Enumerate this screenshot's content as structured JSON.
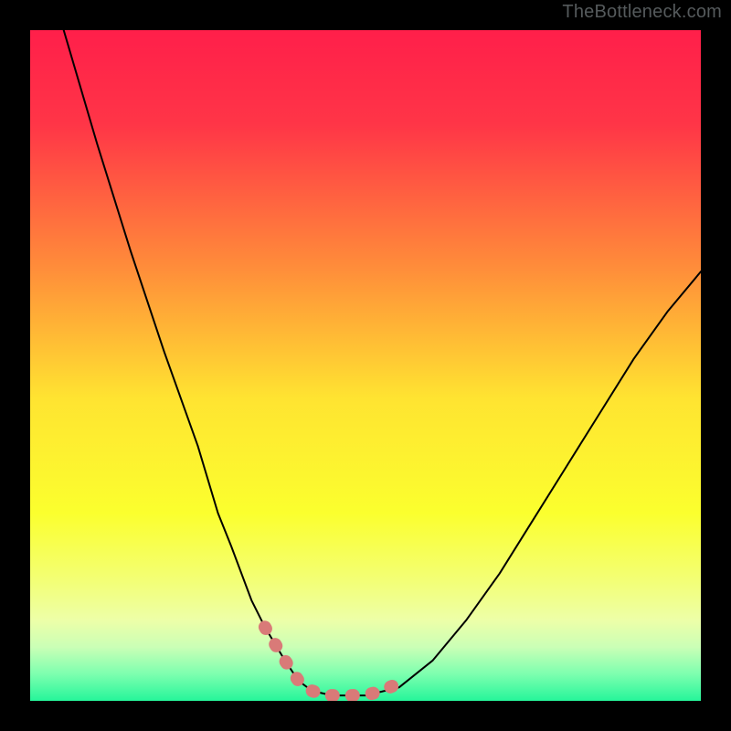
{
  "watermark": "TheBottleneck.com",
  "chart_data": {
    "type": "line",
    "title": "",
    "xlabel": "",
    "ylabel": "",
    "xlim": [
      0,
      100
    ],
    "ylim": [
      0,
      100
    ],
    "series": [
      {
        "name": "bottleneck-curve",
        "x": [
          5,
          10,
          15,
          20,
          25,
          28,
          30,
          33,
          35,
          38,
          40,
          42,
          45,
          50,
          55,
          60,
          65,
          70,
          75,
          80,
          85,
          90,
          95,
          100
        ],
        "values": [
          100,
          83,
          67,
          52,
          38,
          28,
          23,
          15,
          11,
          6,
          3,
          1.5,
          0.8,
          0.8,
          2,
          6,
          12,
          19,
          27,
          35,
          43,
          51,
          58,
          64
        ]
      }
    ],
    "highlight_strip": {
      "name": "highlighted-optimal-segment",
      "x": [
        35,
        38,
        40,
        42,
        44,
        46,
        48,
        50,
        52,
        54
      ],
      "values": [
        11,
        6,
        3,
        1.5,
        0.8,
        0.8,
        0.8,
        0.9,
        1.3,
        2.2
      ]
    },
    "background": {
      "type": "vertical-gradient",
      "stops": [
        {
          "pos": 0.0,
          "color": "#ff1f4a"
        },
        {
          "pos": 0.14,
          "color": "#ff3547"
        },
        {
          "pos": 0.35,
          "color": "#ff8b3a"
        },
        {
          "pos": 0.55,
          "color": "#ffe431"
        },
        {
          "pos": 0.72,
          "color": "#fbff2e"
        },
        {
          "pos": 0.82,
          "color": "#f3ff75"
        },
        {
          "pos": 0.88,
          "color": "#edffa8"
        },
        {
          "pos": 0.92,
          "color": "#caffb6"
        },
        {
          "pos": 0.96,
          "color": "#7dffaf"
        },
        {
          "pos": 1.0,
          "color": "#25f59a"
        }
      ]
    }
  }
}
